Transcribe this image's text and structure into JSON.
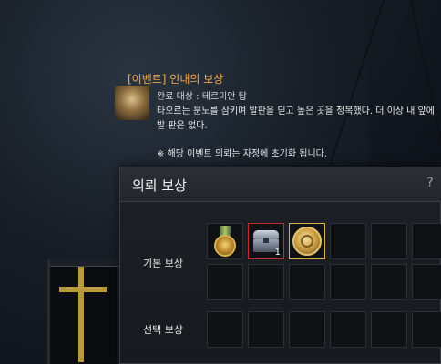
{
  "quest": {
    "title": "[이벤트] 인내의 보상",
    "target": "완료 대상 : 테르미안 탑",
    "description": "타오르는 분노를 삼키며 발판을 딛고 높은 곳을 정복했다. 더 이상 내 앞에 발 판은 없다.",
    "note": "※ 해당 이벤트 의뢰는 자정에 초기화 됩니다."
  },
  "rewards_panel": {
    "title": "의뢰 보상",
    "help_label": "?",
    "basic_label": "기본 보상",
    "select_label": "선택 보상",
    "basic_items": [
      {
        "icon": "medal-icon",
        "count": ""
      },
      {
        "icon": "chest-icon",
        "count": "1"
      },
      {
        "icon": "coin-icon",
        "count": ""
      }
    ]
  },
  "colors": {
    "quest_title": "#f0a84a",
    "slot_border_red": "#c0302a",
    "slot_border_gold": "#d9b04a"
  }
}
